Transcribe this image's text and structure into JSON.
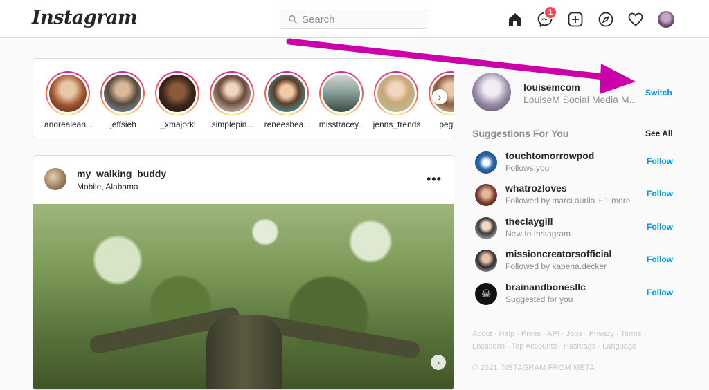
{
  "header": {
    "logo": "Instagram",
    "search_placeholder": "Search",
    "messages_badge": "1"
  },
  "icons": {
    "home": "home-icon",
    "messenger": "messenger-icon",
    "new_post": "new-post-icon",
    "explore": "compass-icon",
    "activity": "heart-icon",
    "profile": "avatar"
  },
  "stories": [
    {
      "username": "andrealean..."
    },
    {
      "username": "jeffsieh"
    },
    {
      "username": "_xmajorki"
    },
    {
      "username": "simplepin..."
    },
    {
      "username": "reneeshea..."
    },
    {
      "username": "misstracey..."
    },
    {
      "username": "jenns_trends"
    },
    {
      "username": "pegfitz"
    }
  ],
  "post": {
    "username": "my_walking_buddy",
    "location": "Mobile, Alabama",
    "more": "•••"
  },
  "sidebar": {
    "account": {
      "username": "louisemcom",
      "name": "LouiseM Social Media M...",
      "switch_label": "Switch"
    },
    "suggestions_title": "Suggestions For You",
    "see_all": "See All",
    "suggestions": [
      {
        "username": "touchtomorrowpod",
        "subtitle": "Follows you",
        "action": "Follow"
      },
      {
        "username": "whatrozloves",
        "subtitle": "Followed by marci.aurila + 1 more",
        "action": "Follow"
      },
      {
        "username": "theclaygill",
        "subtitle": "New to Instagram",
        "action": "Follow"
      },
      {
        "username": "missioncreatorsofficial",
        "subtitle": "Followed by kapena.decker",
        "action": "Follow"
      },
      {
        "username": "brainandbonesllc",
        "subtitle": "Suggested for you",
        "action": "Follow"
      }
    ],
    "footer_links": "About · Help · Press · API · Jobs · Privacy · Terms · Locations · Top Accounts · Hashtags · Language",
    "copyright": "© 2021 INSTAGRAM FROM META"
  },
  "colors": {
    "accent": "#0095f6",
    "annotation_arrow": "#cc00aa",
    "badge": "#ed4956"
  }
}
